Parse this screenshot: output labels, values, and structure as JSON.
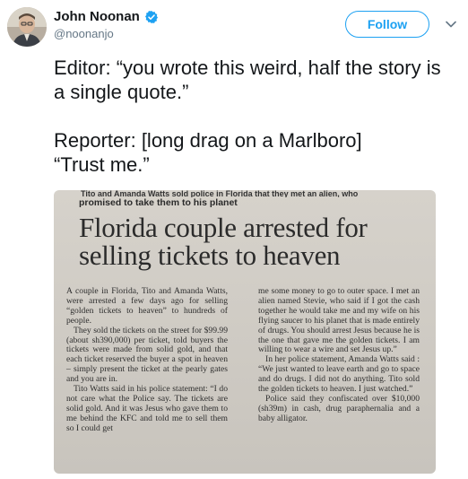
{
  "tweet": {
    "display_name": "John Noonan",
    "handle": "@noonanjo",
    "follow_label": "Follow",
    "text": "Editor: “you wrote this weird, half the story is a single quote.”\n\nReporter: [long drag on a Marlboro]\n“Trust me.”"
  },
  "clipping": {
    "cut_line": "Tito and Amanda Watts sold police in Florida that they met an alien, who",
    "kicker": "promised to take them to his planet",
    "headline": "Florida couple arrested for selling tickets to heaven",
    "left_column": [
      "A couple in Florida, Tito and Amanda Watts, were arrested a few days ago for selling “golden tickets to heaven” to hundreds of people.",
      "They sold the tickets on the street for $99.99 (about sh390,000) per ticket, told buyers the tickets were made from solid gold, and that each ticket reserved the buyer a spot in heaven – simply present the ticket at the pearly gates and you are in.",
      "Tito Watts said in his police statement: “I do not care what the Police say. The tickets are solid gold. And it was Jesus who gave them to me behind the KFC and told me to sell them so I could get"
    ],
    "right_column": [
      "me some money to go to outer space. I met an alien named Stevie, who said if I got the cash together he would take me and my wife on his flying saucer to his planet that is made entirely of drugs. You should arrest Jesus because he is the one that gave me the golden tickets. I am willing to wear a wire and set Jesus up.”",
      "In her police statement, Amanda Watts said : “We just wanted to leave earth and go to space and do drugs. I did not do anything. Tito sold the golden tickets to heaven. I just watched.”",
      "Police said they confiscated over $10,000 (sh39m) in cash, drug paraphernalia and a baby alligator."
    ]
  },
  "colors": {
    "accent": "#1da1f2",
    "text_primary": "#14171a",
    "text_secondary": "#657786"
  },
  "icons": {
    "verified": "verified-badge-icon",
    "caret": "chevron-down-icon",
    "avatar": "avatar"
  }
}
